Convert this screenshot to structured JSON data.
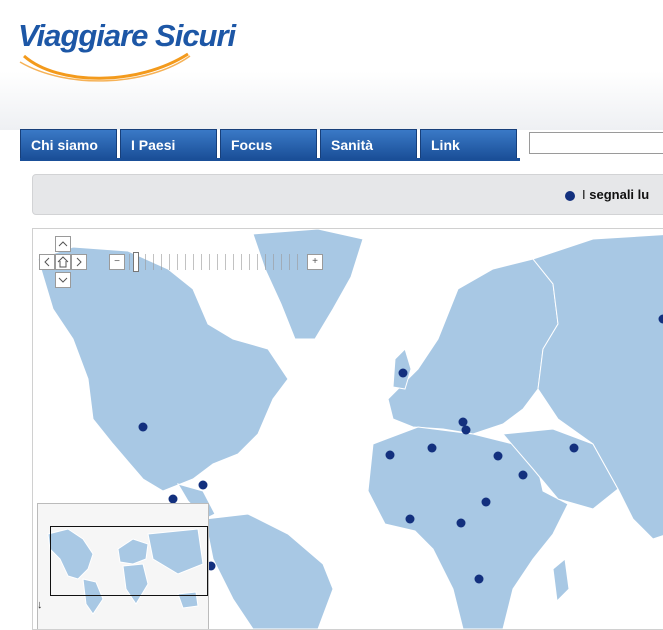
{
  "site": {
    "logo_text": "Viaggiare Sicuri"
  },
  "nav": {
    "tabs": [
      {
        "label": "Chi siamo"
      },
      {
        "label": "I Paesi"
      },
      {
        "label": "Focus"
      },
      {
        "label": "Sanità"
      },
      {
        "label": "Link"
      }
    ]
  },
  "search": {
    "value": ""
  },
  "legend": {
    "letter": "I",
    "text": "segnali lu"
  },
  "map": {
    "controls": {
      "pan_up_icon": "chevron-up-icon",
      "pan_left_icon": "chevron-left-icon",
      "home_icon": "home-icon",
      "pan_right_icon": "chevron-right-icon",
      "pan_down_icon": "chevron-down-icon",
      "zoom_out_label": "−",
      "zoom_in_label": "+"
    },
    "overview_toggle_icon": "↓"
  },
  "colors": {
    "brand_blue": "#1d57a6",
    "accent_orange": "#f39a1c",
    "tab_blue": "#1a4f98",
    "land": "#a8c8e4",
    "marker": "#13307e"
  }
}
